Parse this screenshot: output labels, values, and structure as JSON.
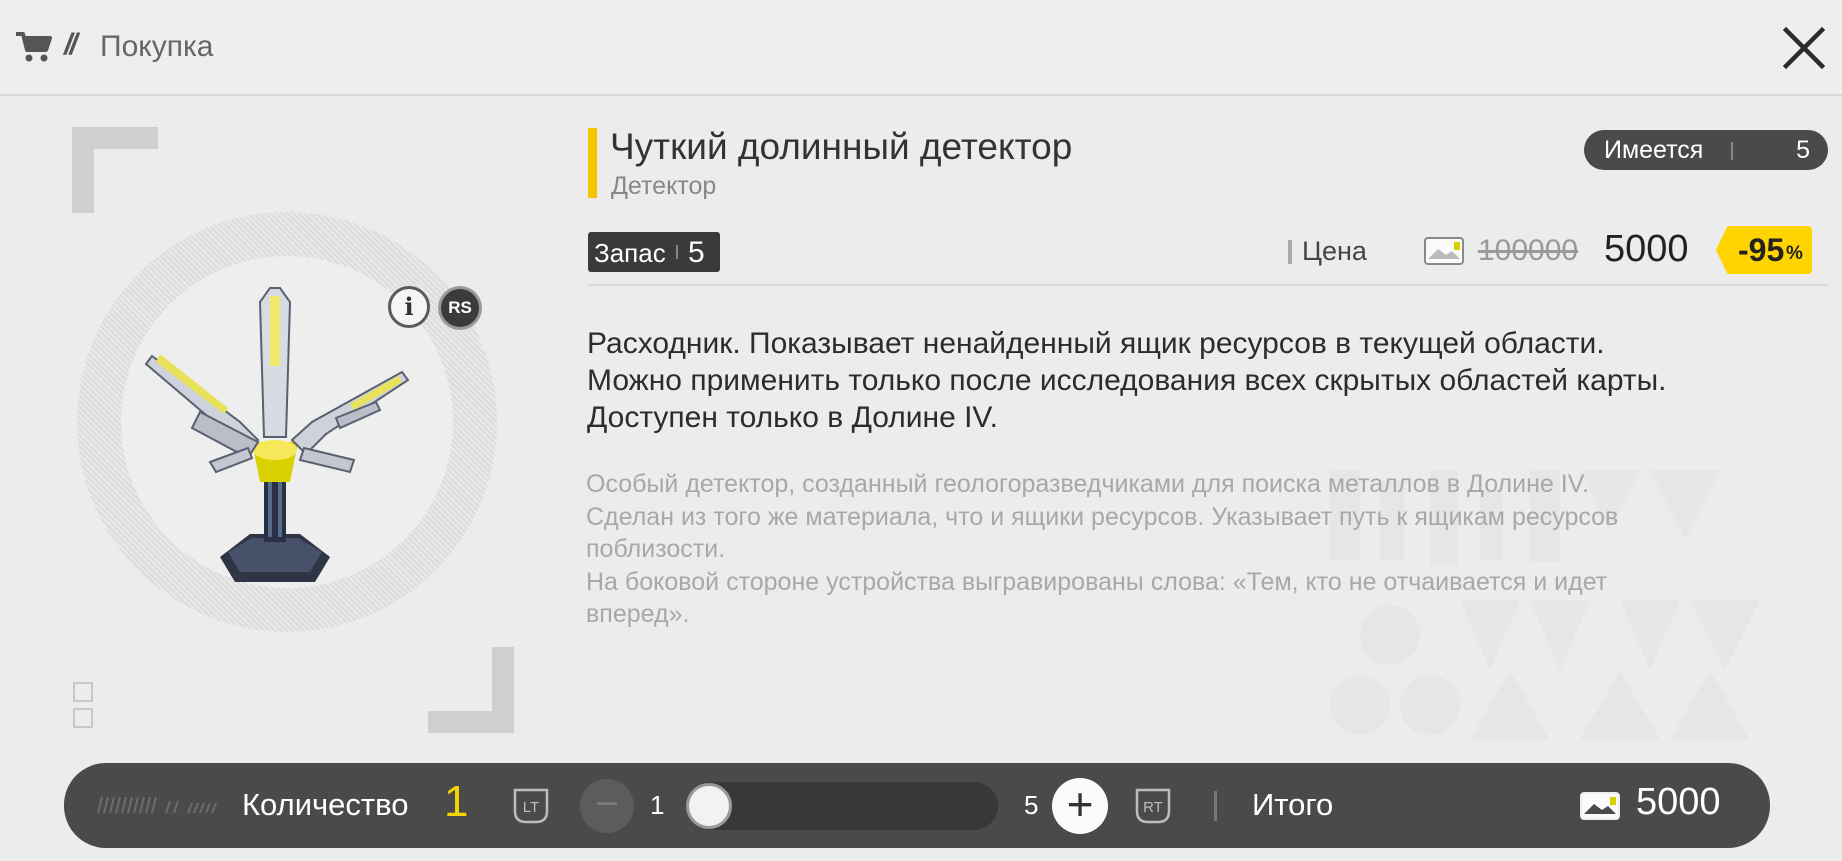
{
  "header": {
    "title": "Покупка",
    "slashes": "//"
  },
  "item": {
    "name": "Чуткий долинный детектор",
    "type": "Детектор",
    "owned_label": "Имеется",
    "owned_value": "5",
    "stock_label": "Запас",
    "stock_value": "5",
    "info_icon_label": "i",
    "rs_label": "RS"
  },
  "price": {
    "label": "Цена",
    "old": "100000",
    "new": "5000",
    "discount": "-95",
    "discount_symbol": "%"
  },
  "description": {
    "main": [
      "Расходник. Показывает ненайденный ящик ресурсов в текущей области.",
      "Можно применить только после исследования всех скрытых областей карты.",
      "Доступен только в Долине IV."
    ],
    "lore": [
      "Особый детектор, созданный геологоразведчиками для поиска металлов в Долине IV.",
      "Сделан из того же материала, что и ящики ресурсов. Указывает путь к ящикам ресурсов",
      "поблизости.",
      "На боковой стороне устройства выгравированы слова: «Тем, кто не отчаивается и идет",
      "вперед»."
    ]
  },
  "purchase_bar": {
    "quantity_label": "Количество",
    "quantity_value": "1",
    "lt_label": "LT",
    "rt_label": "RT",
    "minus": "−",
    "plus": "+",
    "min": "1",
    "max": "5",
    "slider_fraction": 0,
    "total_label": "Итого",
    "total_value": "5000"
  },
  "colors": {
    "accent_yellow": "#f5c400",
    "discount_yellow": "#ffd400",
    "bar_bg": "#4a4a4a"
  },
  "icons": [
    "cart-icon",
    "close-icon",
    "info-icon",
    "currency-icon",
    "lt-trigger-icon",
    "rt-trigger-icon",
    "minus-icon",
    "plus-icon"
  ]
}
